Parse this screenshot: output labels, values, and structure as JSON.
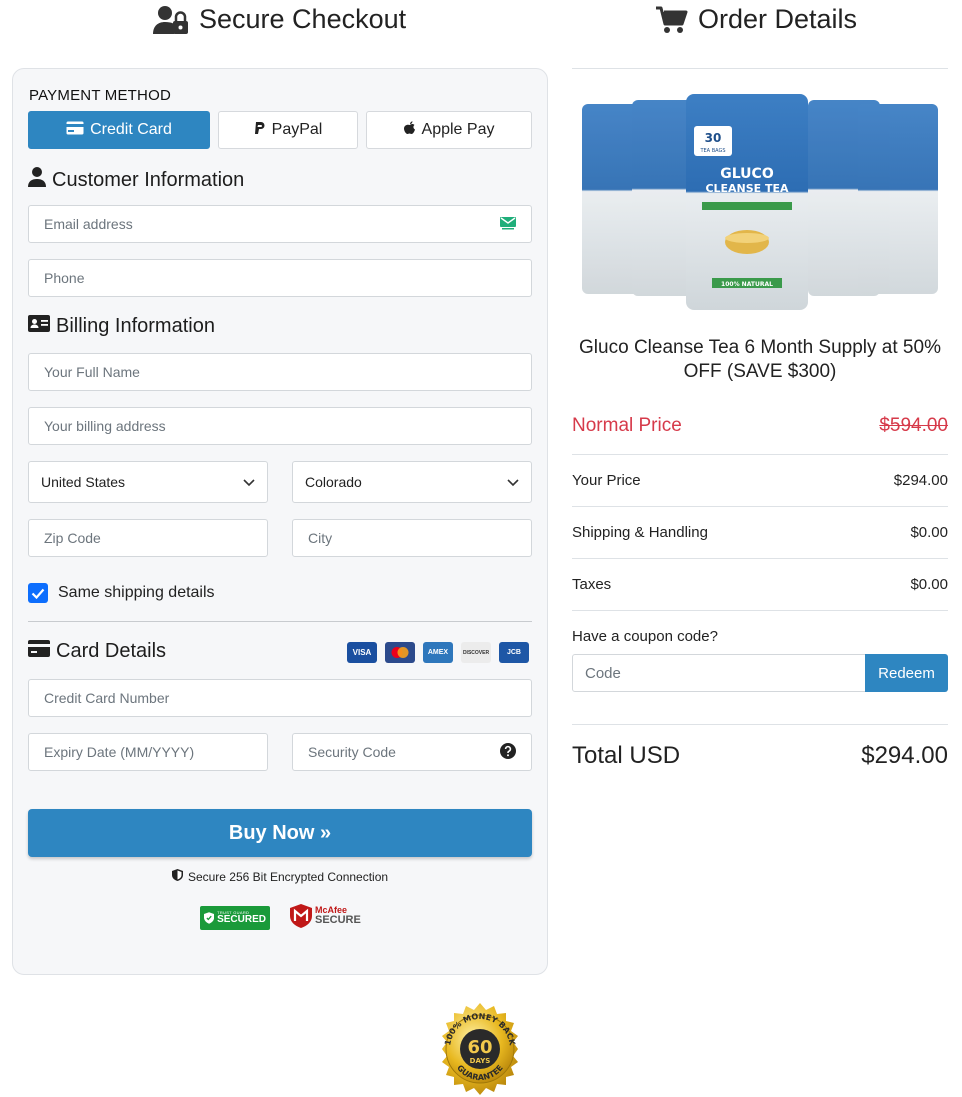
{
  "header": {
    "checkout_title": "Secure Checkout",
    "order_title": "Order Details"
  },
  "payment": {
    "label": "PAYMENT METHOD",
    "methods": [
      {
        "label": "Credit Card",
        "icon": "credit-card-icon",
        "active": true
      },
      {
        "label": "PayPal",
        "icon": "paypal-icon",
        "active": false
      },
      {
        "label": "Apple Pay",
        "icon": "apple-icon",
        "active": false
      }
    ]
  },
  "customer": {
    "heading": "Customer Information",
    "email_placeholder": "Email address",
    "phone_placeholder": "Phone"
  },
  "billing": {
    "heading": "Billing Information",
    "name_placeholder": "Your Full Name",
    "address_placeholder": "Your billing address",
    "country": "United States",
    "state": "Colorado",
    "zip_placeholder": "Zip Code",
    "city_placeholder": "City",
    "same_shipping_label": "Same shipping details",
    "same_shipping_checked": true
  },
  "card": {
    "heading": "Card Details",
    "logos": [
      {
        "label": "VISA",
        "color": "#1a4fa0"
      },
      {
        "label": "MC",
        "color": "#2c4a8c"
      },
      {
        "label": "AMEX",
        "color": "#2e77bc"
      },
      {
        "label": "DISCOVER",
        "color": "#e8e8e8"
      },
      {
        "label": "JCB",
        "color": "#1e57a6"
      }
    ],
    "number_placeholder": "Credit Card Number",
    "expiry_placeholder": "Expiry Date (MM/YYYY)",
    "cvc_placeholder": "Security Code"
  },
  "buy": {
    "label": "Buy Now »",
    "secure_text": "Secure 256 Bit Encrypted Connection"
  },
  "badges": {
    "trust_top": "TRUST GUARD",
    "trust_main": "SECURED",
    "mcafee_top": "McAfee",
    "mcafee_main": "SECURE"
  },
  "order": {
    "product_name": "Gluco Cleanse Tea 6 Month Supply at 50% OFF (SAVE $300)",
    "pack_text": [
      "30",
      "TEA BAGS",
      "GLUCO",
      "CLEANSE TEA",
      "100% NATURAL"
    ],
    "normal_price_label": "Normal Price",
    "normal_price": "$594.00",
    "your_price_label": "Your Price",
    "your_price": "$294.00",
    "shipping_label": "Shipping & Handling",
    "shipping": "$0.00",
    "taxes_label": "Taxes",
    "taxes": "$0.00",
    "coupon_label": "Have a coupon code?",
    "coupon_placeholder": "Code",
    "redeem_label": "Redeem",
    "total_label": "Total USD",
    "total": "$294.00"
  },
  "guarantee": {
    "top_text": "100% MONEY BACK",
    "number": "60",
    "unit": "DAYS",
    "bottom_text": "GUARANTEE"
  },
  "colors": {
    "accent": "#2e86c1",
    "normal_price": "#d63a4a",
    "check": "#0d6efd"
  }
}
